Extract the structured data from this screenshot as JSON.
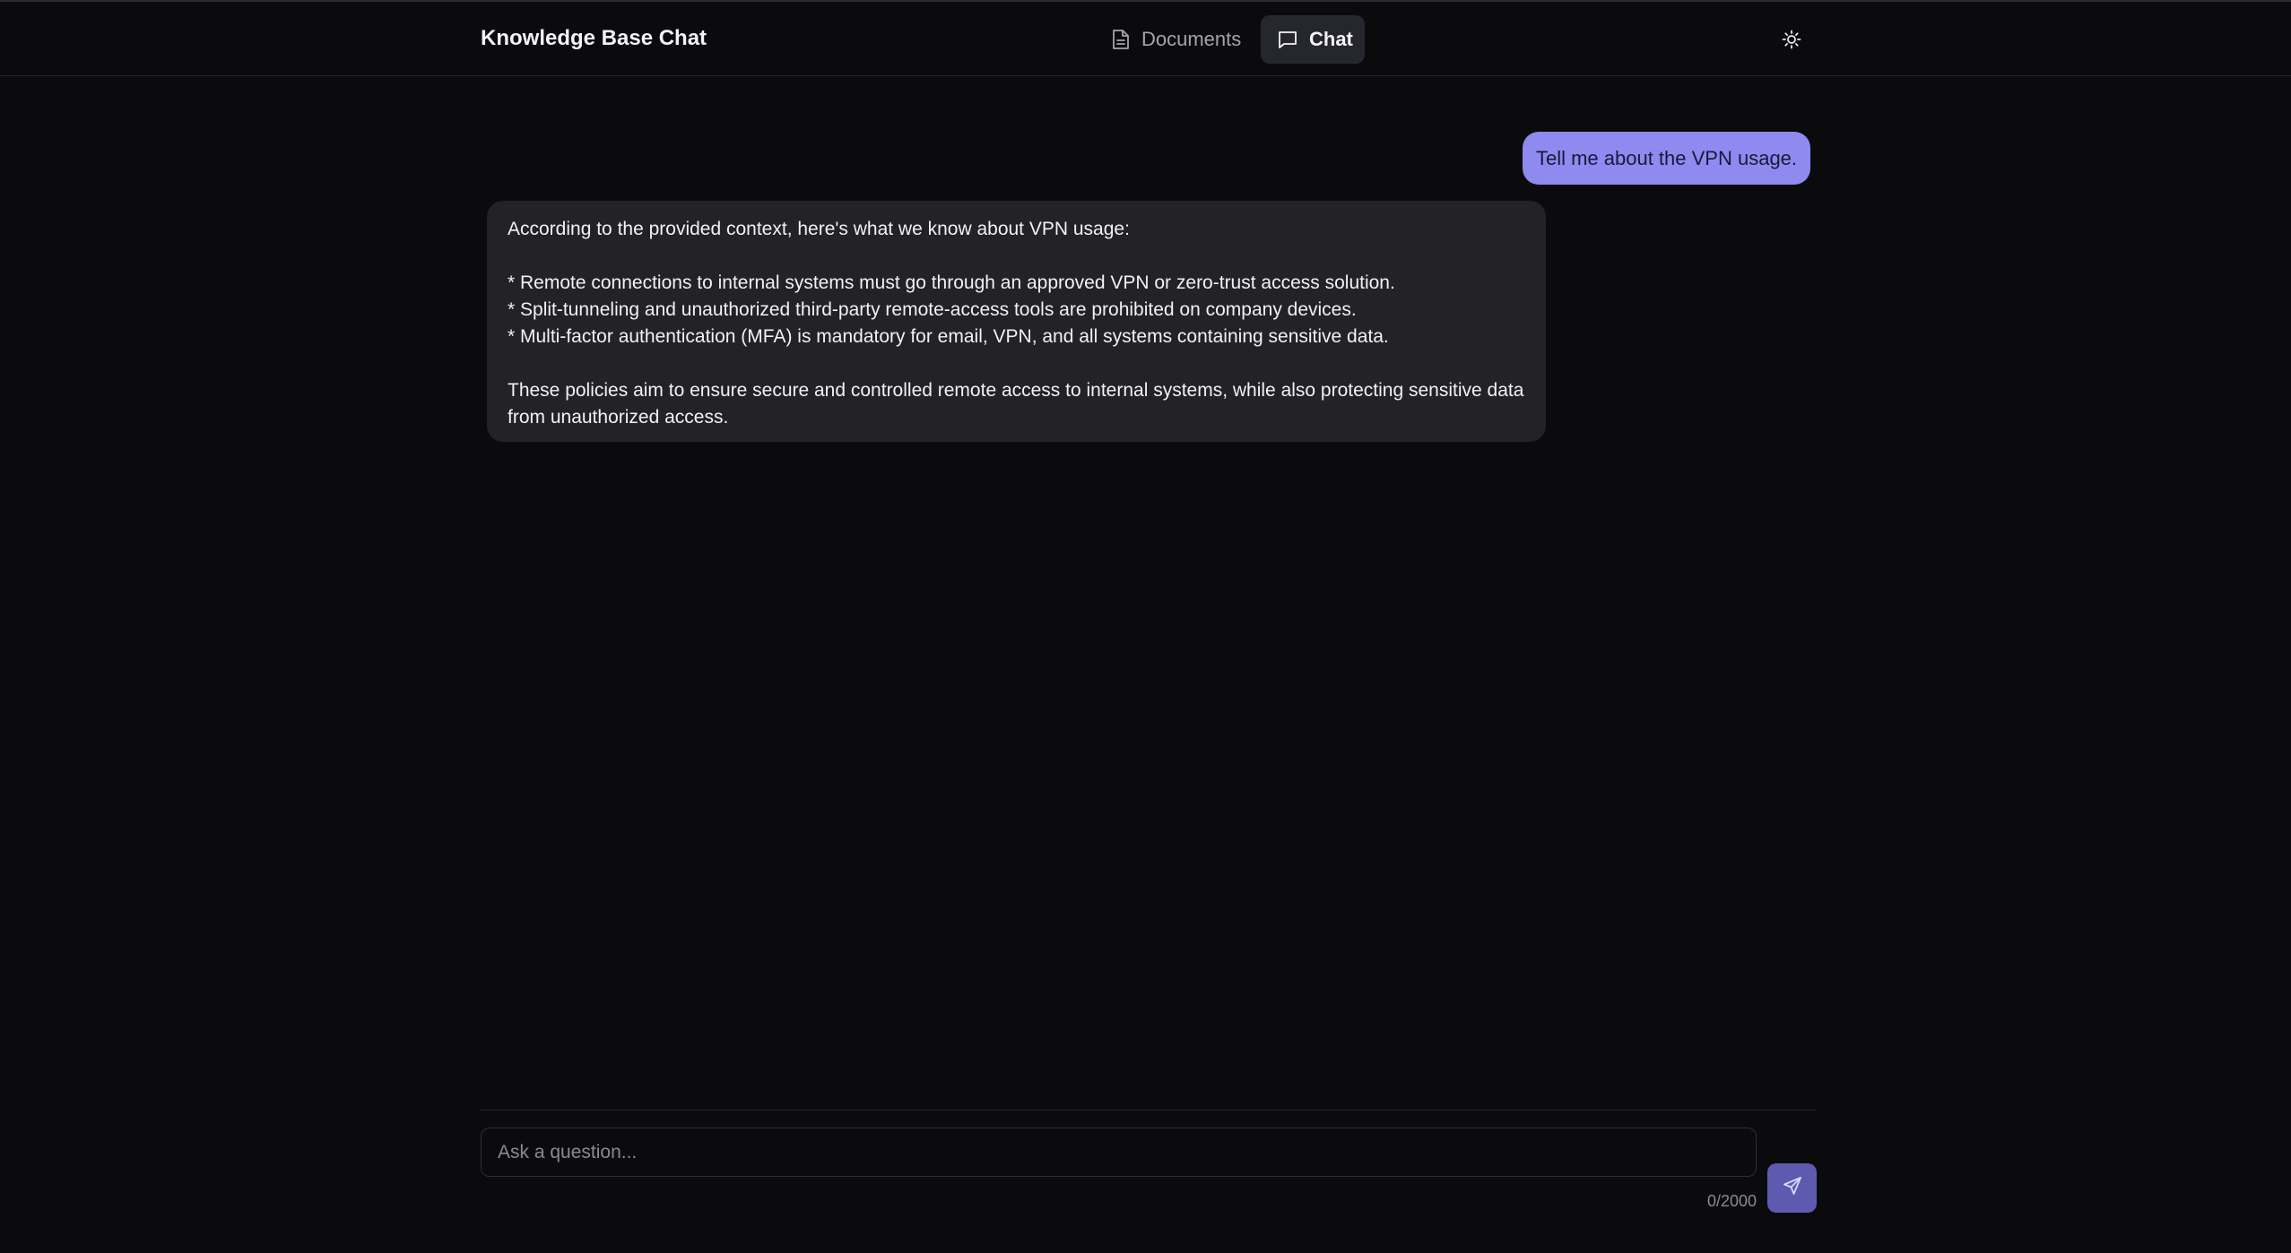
{
  "header": {
    "app_title": "Knowledge Base Chat",
    "tabs": [
      {
        "label": "Documents",
        "icon": "document-icon",
        "active": false
      },
      {
        "label": "Chat",
        "icon": "chat-bubble-icon",
        "active": true
      }
    ],
    "theme_toggle_icon": "sun-icon"
  },
  "conversation": {
    "messages": [
      {
        "role": "user",
        "text": "Tell me about the VPN usage."
      },
      {
        "role": "assistant",
        "text": "According to the provided context, here's what we know about VPN usage:\n\n* Remote connections to internal systems must go through an approved VPN or zero-trust access solution.\n* Split-tunneling and unauthorized third-party remote-access tools are prohibited on company devices.\n* Multi-factor authentication (MFA) is mandatory for email, VPN, and all systems containing sensitive data.\n\nThese policies aim to ensure secure and controlled remote access to internal systems, while also protecting sensitive data from unauthorized access."
      }
    ]
  },
  "composer": {
    "placeholder": "Ask a question...",
    "value": "",
    "char_count": "0/2000",
    "send_icon": "send-icon"
  },
  "colors": {
    "background": "#0b0b0e",
    "user_bubble": "#8e8af0",
    "assistant_bubble": "#222227",
    "active_tab": "#26262f",
    "send_button": "#5e5ab0"
  }
}
